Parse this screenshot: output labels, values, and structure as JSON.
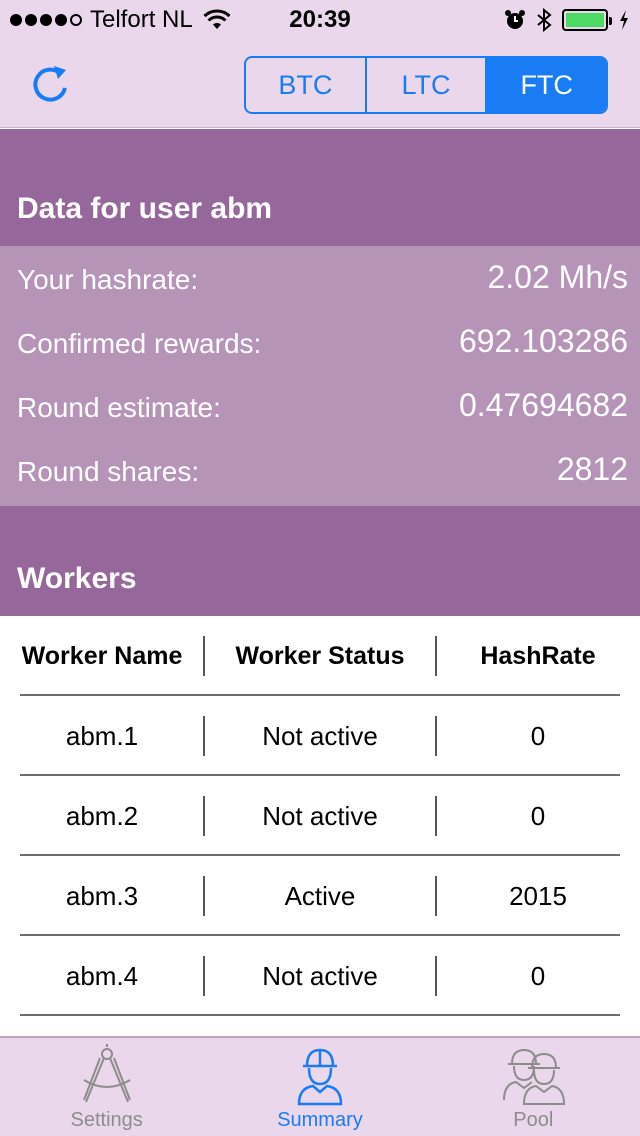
{
  "status_bar": {
    "carrier": "Telfort NL",
    "time": "20:39",
    "signal_bars": 4,
    "battery_level": 1.0
  },
  "nav": {
    "segments": [
      "BTC",
      "LTC",
      "FTC"
    ],
    "selected_segment": "FTC"
  },
  "user_section": {
    "title": "Data for user abm",
    "rows": [
      {
        "label": "Your hashrate:",
        "value": "2.02 Mh/s"
      },
      {
        "label": "Confirmed rewards:",
        "value": "692.103286"
      },
      {
        "label": "Round estimate:",
        "value": "0.47694682"
      },
      {
        "label": "Round shares:",
        "value": "2812"
      }
    ]
  },
  "workers_section": {
    "title": "Workers",
    "columns": [
      "Worker Name",
      "Worker Status",
      "HashRate"
    ],
    "rows": [
      [
        "abm.1",
        "Not active",
        "0"
      ],
      [
        "abm.2",
        "Not active",
        "0"
      ],
      [
        "abm.3",
        "Active",
        "2015"
      ],
      [
        "abm.4",
        "Not active",
        "0"
      ]
    ]
  },
  "tab_bar": {
    "tabs": [
      {
        "label": "Settings",
        "icon": "compass-icon",
        "active": false
      },
      {
        "label": "Summary",
        "icon": "worker-icon",
        "active": true
      },
      {
        "label": "Pool",
        "icon": "workers-group-icon",
        "active": false
      }
    ]
  },
  "colors": {
    "accent": "#1a7cf5",
    "header_purple": "#96679a",
    "stats_purple": "#b694b8",
    "bar_background": "#ead7eb"
  }
}
